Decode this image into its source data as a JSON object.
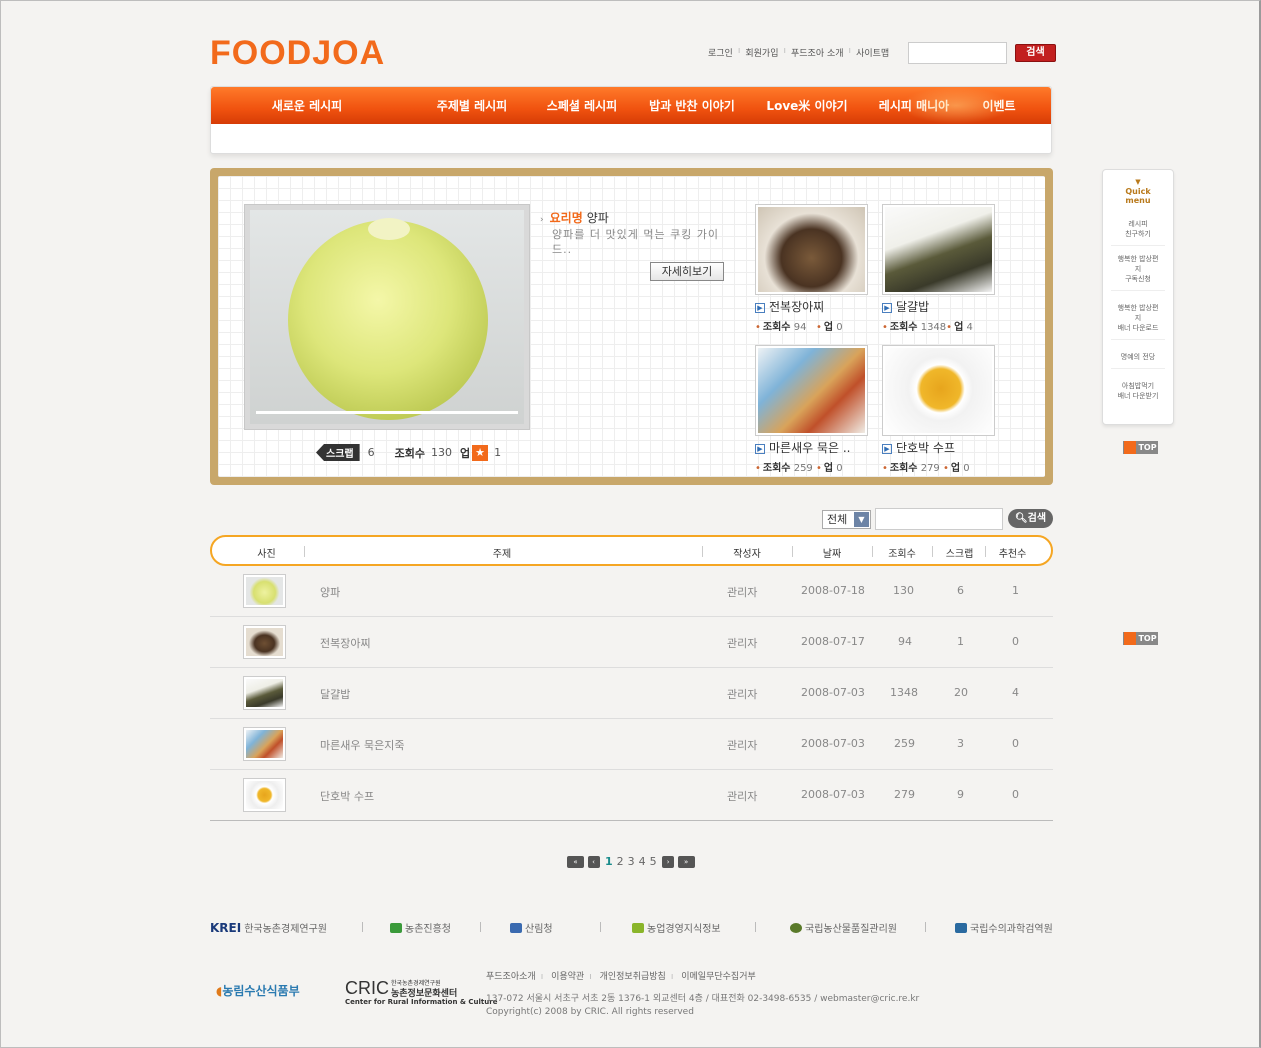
{
  "header": {
    "logo": "FOODJOA",
    "util_links": [
      "로그인",
      "회원가입",
      "푸드조아 소개",
      "사이트맵"
    ],
    "search_button": "검색"
  },
  "nav": {
    "items": [
      "새로운 레시피",
      "주제별 레시피",
      "스페셜 레시피",
      "밥과 반찬 이야기",
      "Love米 이야기",
      "레시피 매니아",
      "이벤트"
    ]
  },
  "feature": {
    "title_label": "요리명",
    "title_name": "양파",
    "description": "양파를 더 맛있게 먹는 쿠킹 가이드..",
    "detail_button": "자세히보기",
    "scrap_label": "스크랩",
    "scrap_count": "6",
    "view_label": "조회수",
    "view_count": "130",
    "up_label": "업",
    "up_count": "1",
    "thumbs": [
      {
        "title": "전복장아찌",
        "views_label": "조회수",
        "views": "94",
        "up_label": "업",
        "up": "0"
      },
      {
        "title": "달걀밥",
        "views_label": "조회수",
        "views": "1348",
        "up_label": "업",
        "up": "4"
      },
      {
        "title": "마른새우 묵은 ..",
        "views_label": "조회수",
        "views": "259",
        "up_label": "업",
        "up": "0"
      },
      {
        "title": "단호박 수프",
        "views_label": "조회수",
        "views": "279",
        "up_label": "업",
        "up": "0"
      }
    ]
  },
  "quick_menu": {
    "title_line1": "Quick",
    "title_line2": "menu",
    "items": [
      [
        "레시피",
        "친구하기"
      ],
      [
        "행복한 밥상편지",
        "구독신청"
      ],
      [
        "행복한 밥상편지",
        "배너 다운로드"
      ],
      [
        "명예의 전당"
      ],
      [
        "아침밥먹기",
        "배너 다운받기"
      ]
    ],
    "top_label": "TOP"
  },
  "list_search": {
    "select_value": "전체",
    "button": "검색"
  },
  "table": {
    "headers": [
      "사진",
      "주제",
      "작성자",
      "날짜",
      "조회수",
      "스크랩",
      "추천수"
    ],
    "rows": [
      {
        "subject": "양파",
        "author": "관리자",
        "date": "2008-07-18",
        "views": "130",
        "scraps": "6",
        "recommends": "1"
      },
      {
        "subject": "전복장아찌",
        "author": "관리자",
        "date": "2008-07-17",
        "views": "94",
        "scraps": "1",
        "recommends": "0"
      },
      {
        "subject": "달걀밥",
        "author": "관리자",
        "date": "2008-07-03",
        "views": "1348",
        "scraps": "20",
        "recommends": "4"
      },
      {
        "subject": "마른새우 묵은지죽",
        "author": "관리자",
        "date": "2008-07-03",
        "views": "259",
        "scraps": "3",
        "recommends": "0"
      },
      {
        "subject": "단호박 수프",
        "author": "관리자",
        "date": "2008-07-03",
        "views": "279",
        "scraps": "9",
        "recommends": "0"
      }
    ]
  },
  "pager": {
    "pages": [
      "1",
      "2",
      "3",
      "4",
      "5"
    ],
    "current": "1"
  },
  "footer": {
    "partners": [
      "한국농촌경제연구원",
      "농촌진흥청",
      "산림청",
      "농업경영지식정보",
      "국립농산물품질관리원",
      "국립수의과학검역원"
    ],
    "krei_logo": "KREI",
    "ministry_logo": "농림수산식품부",
    "cric_logo": "CRIC",
    "cric_sub1": "한국농촌경제연구원",
    "cric_sub2": "농촌정보문화센터",
    "cric_sub3": "Center for Rural Information & Culture",
    "links": [
      "푸드조아소개",
      "이용약관",
      "개인정보취급방침",
      "이메일무단수집거부"
    ],
    "address": "137-072 서울시 서초구 서초 2동 1376-1 외교센터 4층 / 대표전화 02-3498-6535 / webmaster@cric.re.kr",
    "copyright": "Copyright(c) 2008 by CRIC. All rights reserved"
  }
}
